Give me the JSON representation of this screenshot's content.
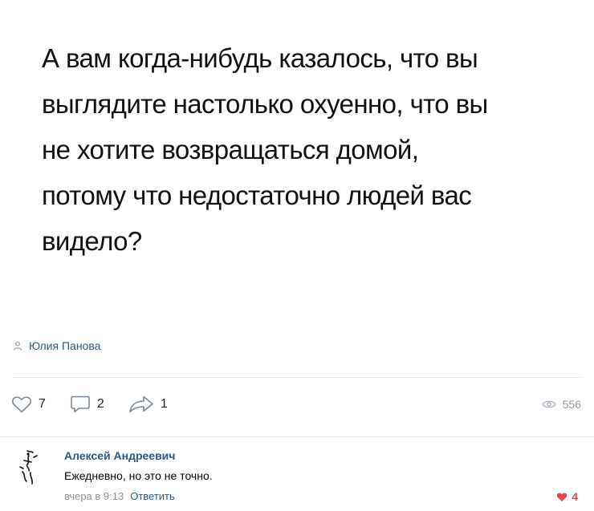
{
  "post": {
    "lines": [
      "А вам когда-нибудь казалось, что вы",
      "выглядите настолько охуенно, что вы",
      "не хотите возвращаться домой,",
      "потому что недостаточно людей вас",
      "видело?"
    ],
    "author": "Юлия Панова"
  },
  "actions": {
    "likes": "7",
    "comments": "2",
    "shares": "1",
    "views": "556"
  },
  "comment": {
    "author": "Алексей Андреевич",
    "text": "Ежедневно, но это не точно.",
    "time": "вчера в 9:13",
    "reply_label": "Ответить",
    "likes": "4"
  },
  "colors": {
    "link": "#2a5885",
    "muted": "#939393",
    "like_active": "#e64646"
  }
}
